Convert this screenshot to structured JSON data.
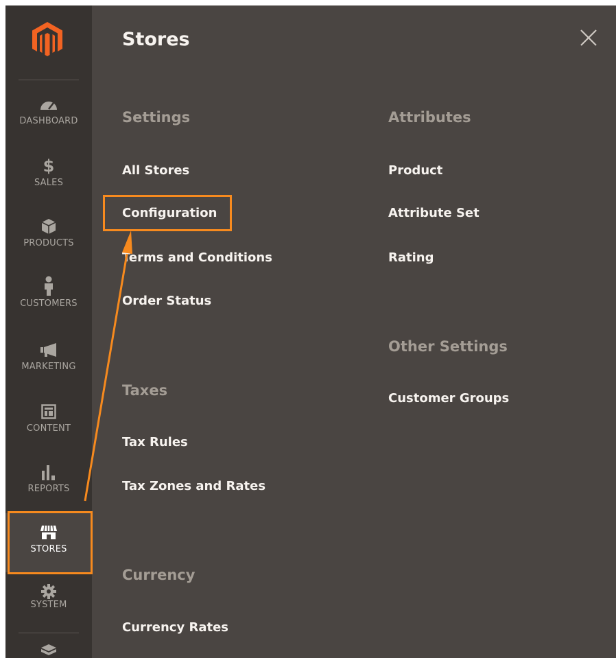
{
  "panel": {
    "title": "Stores",
    "close_icon": "close-icon"
  },
  "sidebar": {
    "logo_icon": "magento-logo-icon",
    "items": [
      {
        "label": "DASHBOARD",
        "icon": "dashboard-icon"
      },
      {
        "label": "SALES",
        "icon": "dollar-icon"
      },
      {
        "label": "PRODUCTS",
        "icon": "cube-icon"
      },
      {
        "label": "CUSTOMERS",
        "icon": "person-icon"
      },
      {
        "label": "MARKETING",
        "icon": "megaphone-icon"
      },
      {
        "label": "CONTENT",
        "icon": "layout-icon"
      },
      {
        "label": "REPORTS",
        "icon": "bar-chart-icon"
      },
      {
        "label": "STORES",
        "icon": "storefront-icon",
        "active": true
      },
      {
        "label": "SYSTEM",
        "icon": "gear-icon"
      },
      {
        "label": "",
        "icon": "bricks-icon"
      }
    ]
  },
  "sections": {
    "settings": {
      "heading": "Settings",
      "items": [
        "All Stores",
        "Configuration",
        "Terms and Conditions",
        "Order Status"
      ]
    },
    "taxes": {
      "heading": "Taxes",
      "items": [
        "Tax Rules",
        "Tax Zones and Rates"
      ]
    },
    "currency": {
      "heading": "Currency",
      "items": [
        "Currency Rates"
      ]
    },
    "attributes": {
      "heading": "Attributes",
      "items": [
        "Product",
        "Attribute Set",
        "Rating"
      ]
    },
    "other_settings": {
      "heading": "Other Settings",
      "items": [
        "Customer Groups"
      ]
    }
  },
  "colors": {
    "sidebar_bg": "#373330",
    "panel_bg": "#4a4542",
    "highlight": "#f78a1e",
    "heading_text": "#a49d95",
    "link_text": "#f7f3ef"
  }
}
